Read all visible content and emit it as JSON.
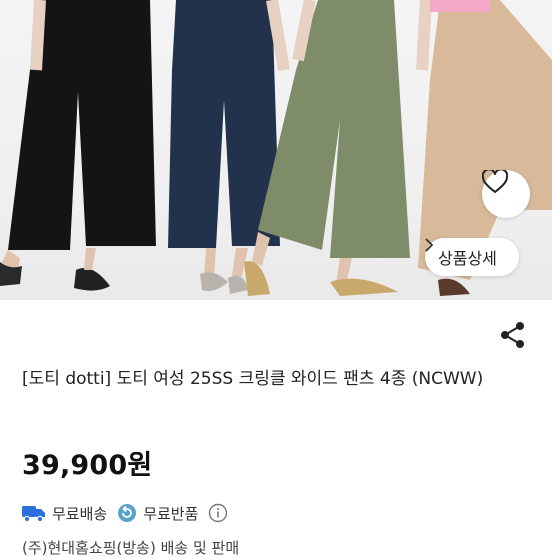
{
  "product": {
    "title": "[도티 dotti] 도티 여성 25SS 크링클 와이드 팬츠 4종 (NCWW)",
    "price": "39,900원",
    "detail_button_label": "상품상세",
    "shipping": [
      {
        "icon": "truck-icon",
        "label": "무료배송"
      },
      {
        "icon": "return-icon",
        "label": "무료반품"
      }
    ],
    "seller_text": "(주)현대홈쇼핑(방송) 배송 및 판매"
  },
  "image": {
    "pants_colors": [
      "#141414",
      "#22324d",
      "#7f8c6a",
      "#d8b99a"
    ]
  },
  "colors": {
    "shipping_icon": "#2a6fdb",
    "return_icon": "#5aa3c8"
  }
}
